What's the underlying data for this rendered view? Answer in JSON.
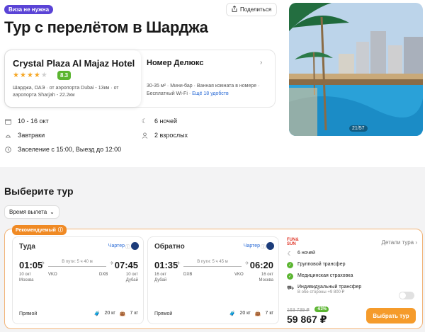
{
  "header": {
    "visa_badge": "Виза не нужна",
    "share_label": "Поделиться",
    "title": "Тур с перелётом в Шарджа"
  },
  "hotel": {
    "name": "Crystal Plaza Al Majaz Hotel",
    "stars": 4,
    "rating": "8.3",
    "location": "Шарджа, ОАЭ · от аэропорта Dubai - 13км · от аэропорта Sharjah - 22.2км"
  },
  "room": {
    "title": "Номер Делюкс",
    "features": "30-35 м² · Мини-бар · Ванная комната в номере · Бесплатный Wi-Fi ·",
    "more_link": "Ещё 18 удобств"
  },
  "details": {
    "dates": "10 - 16 окт",
    "nights": "6 ночей",
    "meals": "Завтраки",
    "guests": "2 взрослых",
    "checkin": "Заселение с 15:00, Выезд до 12:00"
  },
  "photo": {
    "counter": "21/57"
  },
  "tours": {
    "heading": "Выберите тур",
    "filter_label": "Время вылета",
    "recommended_badge": "Рекомендуемый"
  },
  "flights": {
    "outbound": {
      "label": "Туда",
      "charter": "Чартер",
      "dep_time": "01:05",
      "dep_date": "10 окт",
      "dep_city": "Москва",
      "arr_time": "07:45",
      "arr_date": "10 окт",
      "arr_city": "Дубай",
      "duration": "В пути: 5 ч 40 м",
      "from_code": "VKO",
      "to_code": "DXB",
      "direct": "Прямой",
      "bag": "20 кг",
      "carry": "7 кг"
    },
    "return": {
      "label": "Обратно",
      "charter": "Чартер",
      "dep_time": "01:35",
      "dep_date": "16 окт",
      "dep_city": "Дубай",
      "arr_time": "06:20",
      "arr_date": "16 окт",
      "arr_city": "Москва",
      "duration": "В пути: 5 ч 45 м",
      "from_code": "DXB",
      "to_code": "VKO",
      "direct": "Прямой",
      "bag": "20 кг",
      "carry": "7 кг"
    }
  },
  "offer": {
    "operator_line1": "FUN&",
    "operator_line2": "SUN",
    "details_link": "Детали тура",
    "nights": "6 ночей",
    "group_transfer": "Групповой трансфер",
    "insurance": "Медицинская страховка",
    "individual_transfer": "Индивидуальный трансфер",
    "individual_transfer_sub": "В обе стороны +9 800 ₽",
    "old_price": "163 739 ₽",
    "discount": "-63%",
    "price": "59 867 ₽",
    "buy_label": "Выбрать тур"
  },
  "colors": {
    "accent_orange": "#f59b2b",
    "badge_purple": "#5a43d6",
    "rating_green": "#5bb531",
    "link_blue": "#2a6bd6"
  }
}
